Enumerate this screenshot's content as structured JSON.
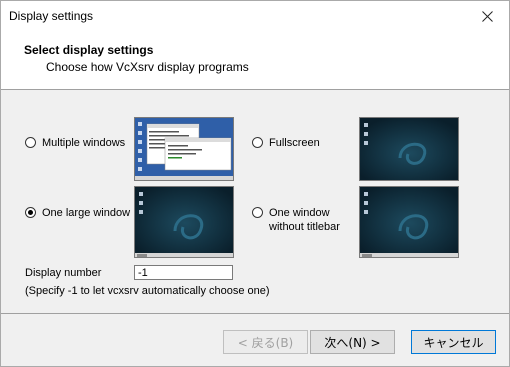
{
  "window": {
    "title": "Display settings"
  },
  "header": {
    "title": "Select display settings",
    "subtitle": "Choose how VcXsrv display programs"
  },
  "options": {
    "multiple": {
      "label": "Multiple windows",
      "checked": false
    },
    "fullscreen": {
      "label": "Fullscreen",
      "checked": false
    },
    "one_large": {
      "label": "One large window",
      "checked": true
    },
    "no_titlebar": {
      "label_line1": "One window",
      "label_line2": "without titlebar",
      "checked": false
    }
  },
  "display_number": {
    "label": "Display number",
    "value": "-1",
    "note": "(Specify -1 to let vcxsrv automatically choose one)"
  },
  "buttons": {
    "back": "< 戻る(B)",
    "next": "次へ(N) >",
    "cancel": "キャンセル"
  },
  "colors": {
    "accent": "#0078d7",
    "desktop_blue": "#2f5fa8",
    "desktop_dark": "#0c2a3a"
  }
}
